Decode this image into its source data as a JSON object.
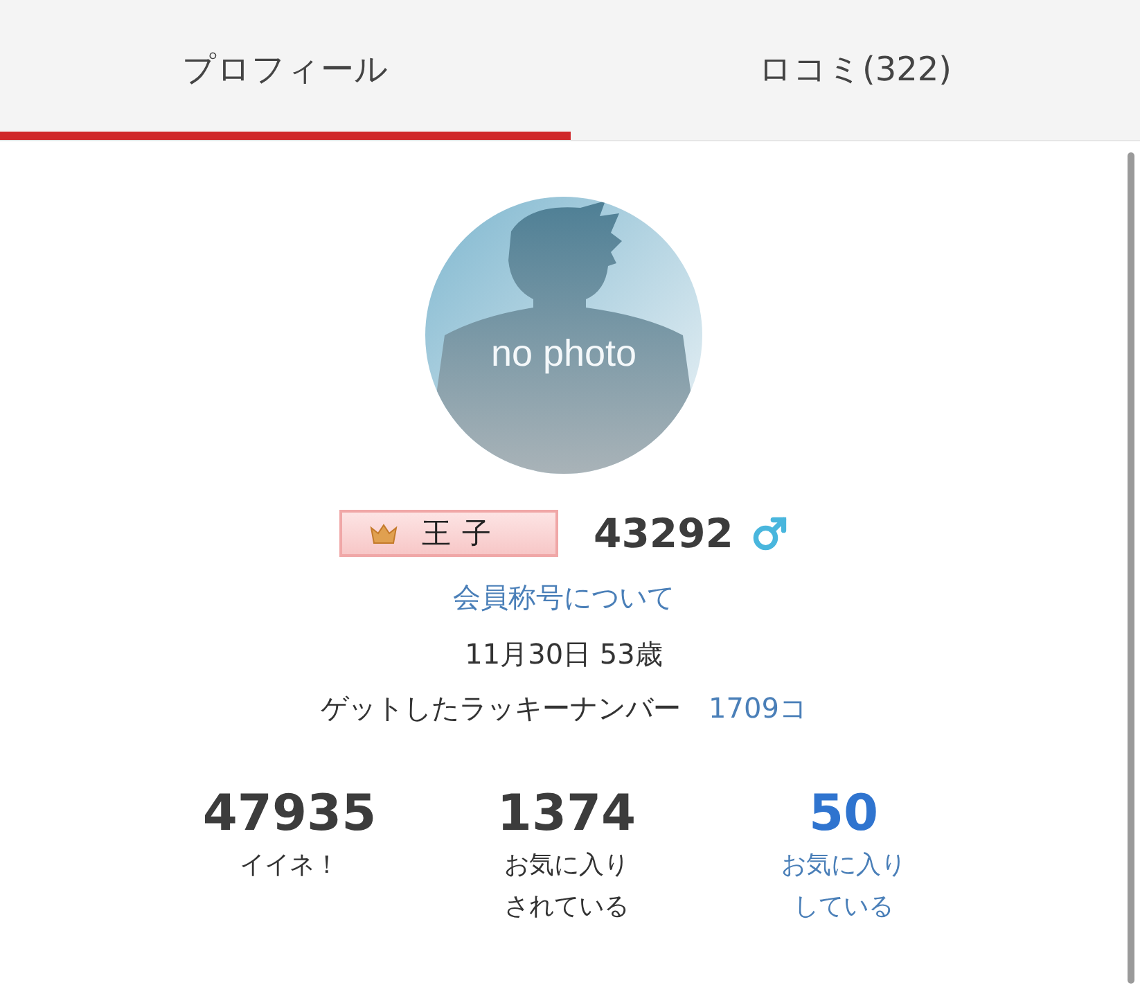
{
  "tabs": [
    {
      "label": "プロフィール",
      "selected": true
    },
    {
      "label": "ロコミ(322)",
      "selected": false
    }
  ],
  "profile": {
    "photo_text": "no photo",
    "title_badge": "王子",
    "member_id": "43292",
    "male": true,
    "title_link": "会員称号について",
    "birthday_age": "11月30日 53歳",
    "lucky_label": "ゲットしたラッキーナンバー",
    "lucky_count": "1709コ"
  },
  "stats": [
    {
      "value": "47935",
      "label": "イイネ！",
      "kind": "plain"
    },
    {
      "value": "1374",
      "label": "お気に入りされている",
      "kind": "plain"
    },
    {
      "value": "50",
      "label": "お気に入りしている",
      "kind": "link"
    }
  ]
}
